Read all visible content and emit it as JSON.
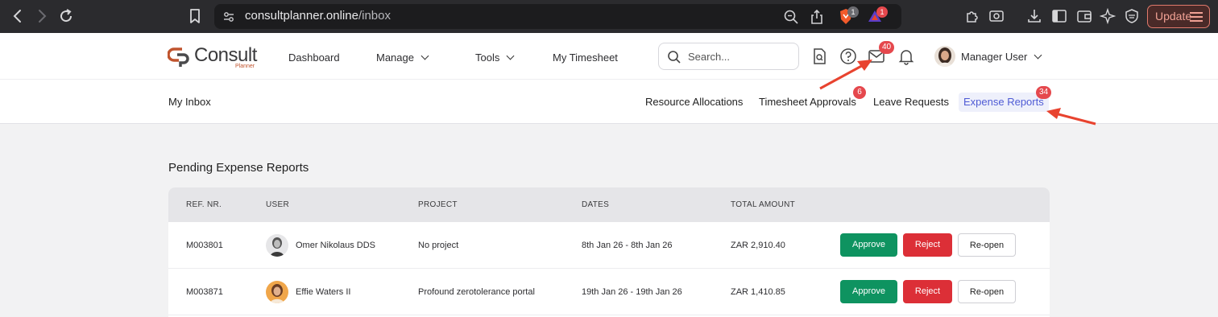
{
  "browser": {
    "url_host": "consultplanner.online",
    "url_path": "/inbox",
    "brave_badge": "1",
    "ext_badge": "1",
    "update_label": "Update"
  },
  "app": {
    "logo_text": "Consult",
    "logo_sub": "Planner",
    "nav": {
      "dashboard": "Dashboard",
      "manage": "Manage",
      "tools": "Tools",
      "timesheet": "My Timesheet"
    },
    "search_placeholder": "Search...",
    "mail_badge": "40",
    "user_name": "Manager User"
  },
  "subnav": {
    "title": "My Inbox",
    "tabs": {
      "resource": "Resource Allocations",
      "timesheet": "Timesheet Approvals",
      "timesheet_badge": "6",
      "leave": "Leave Requests",
      "expense": "Expense Reports",
      "expense_badge": "34"
    }
  },
  "section_title": "Pending Expense Reports",
  "table": {
    "headers": [
      "REF. NR.",
      "USER",
      "PROJECT",
      "DATES",
      "TOTAL AMOUNT"
    ],
    "rows": [
      {
        "ref": "M003801",
        "user": "Omer Nikolaus DDS",
        "project": "No project",
        "dates": "8th Jan 26 - 8th Jan 26",
        "amount": "ZAR 2,910.40"
      },
      {
        "ref": "M003871",
        "user": "Effie Waters II",
        "project": "Profound zerotolerance portal",
        "dates": "19th Jan 26 - 19th Jan 26",
        "amount": "ZAR 1,410.85"
      }
    ],
    "actions": {
      "approve": "Approve",
      "reject": "Reject",
      "reopen": "Re-open"
    }
  },
  "colors": {
    "accent": "#4f5bd5",
    "approve": "#0e9360",
    "reject": "#dc2f37",
    "badge": "#e5484d",
    "annotation_arrow": "#e8432f"
  }
}
